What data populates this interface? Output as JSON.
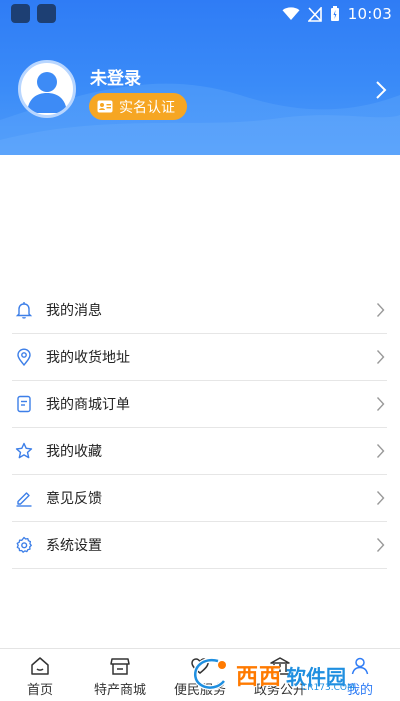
{
  "status_bar": {
    "time": "10:03"
  },
  "profile": {
    "name": "未登录",
    "verify_label": "实名认证"
  },
  "menu": {
    "items": [
      {
        "label": "我的消息",
        "icon": "bell-icon"
      },
      {
        "label": "我的收货地址",
        "icon": "location-pin-icon"
      },
      {
        "label": "我的商城订单",
        "icon": "document-icon"
      },
      {
        "label": "我的收藏",
        "icon": "star-icon"
      },
      {
        "label": "意见反馈",
        "icon": "edit-pen-icon"
      },
      {
        "label": "系统设置",
        "icon": "gear-icon"
      }
    ]
  },
  "bottom_nav": {
    "items": [
      {
        "label": "首页",
        "icon": "home-icon"
      },
      {
        "label": "特产商城",
        "icon": "store-icon"
      },
      {
        "label": "便民服务",
        "icon": "service-icon"
      },
      {
        "label": "政务公开",
        "icon": "government-icon"
      },
      {
        "label": "我的",
        "icon": "user-icon"
      }
    ],
    "active_index": 4
  },
  "watermark": {
    "brand": "西西",
    "text": "软件园",
    "domain": "CR173.COM"
  },
  "colors": {
    "header": "#2f7cf5",
    "accent": "#2f7cf5",
    "pill": "#f6a623",
    "icon_blue": "#3d7fe8"
  }
}
